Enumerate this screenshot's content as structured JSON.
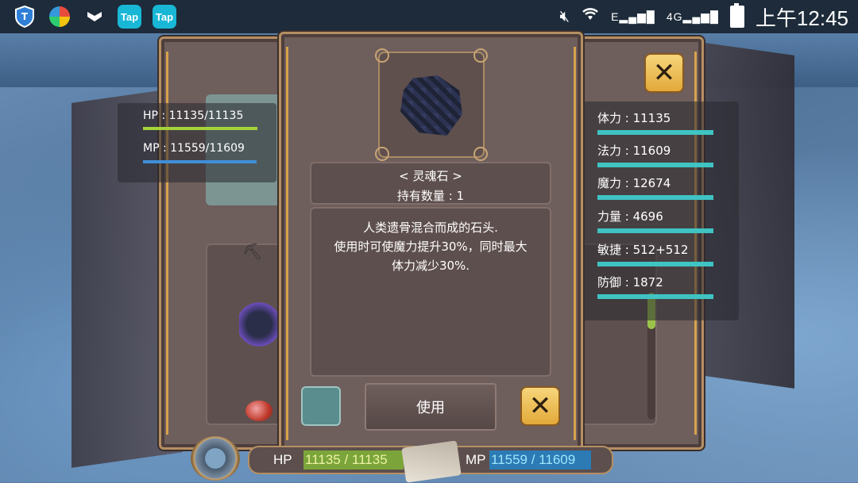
{
  "statusbar": {
    "apps": [
      {
        "name": "shield-app",
        "label": ""
      },
      {
        "name": "circle-app",
        "label": ""
      },
      {
        "name": "mark-app",
        "label": ""
      },
      {
        "name": "tap-app-1",
        "label": "Tap"
      },
      {
        "name": "tap-app-2",
        "label": "Tap"
      }
    ],
    "network": "E",
    "network2": "4G",
    "clock": "上午12:45"
  },
  "left_stats": {
    "hp": "HP : 11135/11135",
    "mp": "MP : 11559/11609",
    "hp_fill": 1.0,
    "mp_fill": 0.9957
  },
  "right_stats": [
    {
      "label": "体力 : 11135"
    },
    {
      "label": "法力 : 11609"
    },
    {
      "label": "魔力 : 12674"
    },
    {
      "label": "力量 : 4696"
    },
    {
      "label": "敏捷 : 512+512"
    },
    {
      "label": "防御 : 1872"
    }
  ],
  "item": {
    "name": "< 灵魂石 >",
    "count": "持有数量 : 1",
    "description": "人类遗骨混合而成的石头.\n使用时可使魔力提升30%，同时最大\n体力减少30%.",
    "use_label": "使用",
    "close_label": "✕"
  },
  "rear_panel": {
    "close_label": "✕"
  },
  "hud": {
    "hp_label": "HP",
    "hp_value": "11135 / 11135",
    "mp_label": "MP",
    "mp_value": "11559 / 11609"
  }
}
